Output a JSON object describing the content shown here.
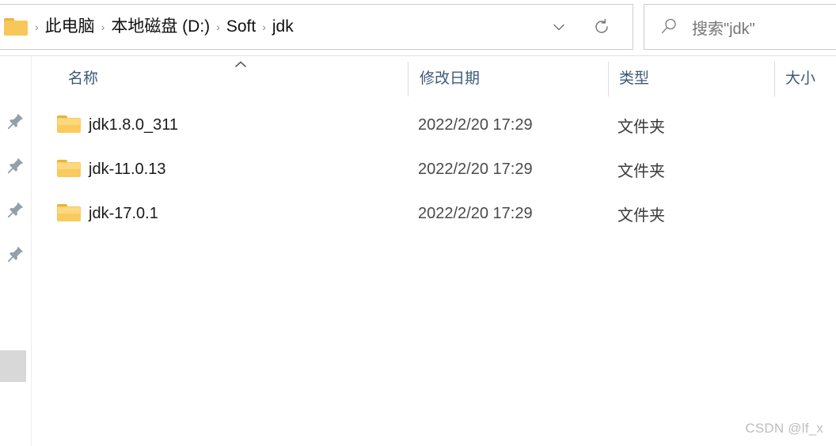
{
  "window": {
    "title": "jdk"
  },
  "address_bar": {
    "folder_icon": "folder-icon",
    "breadcrumb": [
      {
        "label": "此电脑"
      },
      {
        "label": "本地磁盘 (D:)"
      },
      {
        "label": "Soft"
      },
      {
        "label": "jdk"
      }
    ],
    "separator": "›",
    "history_dropdown_icon": "chevron-down-icon",
    "refresh_icon": "refresh-icon"
  },
  "search": {
    "icon": "search-icon",
    "placeholder": "搜索\"jdk\"",
    "value": ""
  },
  "sidebar": {
    "pins": [
      {
        "icon": "pin-icon"
      },
      {
        "icon": "pin-icon"
      },
      {
        "icon": "pin-icon"
      },
      {
        "icon": "pin-icon"
      }
    ],
    "scrollbar": "horizontal-scrollbar-thumb"
  },
  "columns": [
    {
      "key": "name",
      "label": "名称",
      "sorted": "asc",
      "sort_icon": "chevron-up-icon"
    },
    {
      "key": "date",
      "label": "修改日期"
    },
    {
      "key": "type",
      "label": "类型"
    },
    {
      "key": "size",
      "label": "大小"
    }
  ],
  "files": [
    {
      "icon": "folder-icon",
      "name": "jdk1.8.0_311",
      "date": "2022/2/20 17:29",
      "type": "文件夹",
      "size": ""
    },
    {
      "icon": "folder-icon",
      "name": "jdk-11.0.13",
      "date": "2022/2/20 17:29",
      "type": "文件夹",
      "size": ""
    },
    {
      "icon": "folder-icon",
      "name": "jdk-17.0.1",
      "date": "2022/2/20 17:29",
      "type": "文件夹",
      "size": ""
    }
  ],
  "watermark": {
    "text": "CSDN @lf_x"
  },
  "colors": {
    "folder_gold": "#f9cb5f",
    "folder_tab": "#e9b43b",
    "header_text": "#3c5a78",
    "border": "#cccccc",
    "scrollbar_thumb": "#d8d8d8",
    "watermark": "#bdbdbd"
  }
}
